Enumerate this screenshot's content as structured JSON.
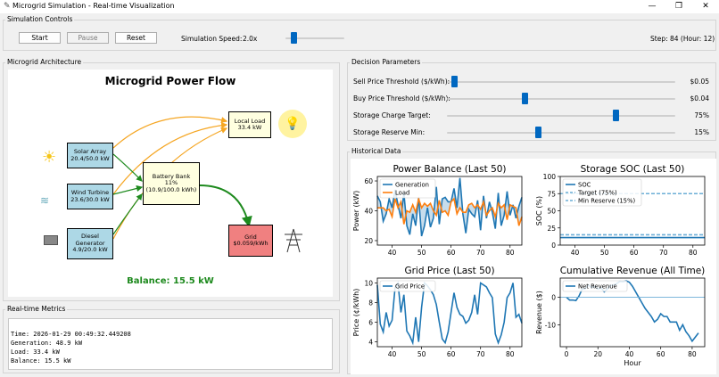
{
  "window": {
    "title": "Microgrid Simulation - Real-time Visualization",
    "min_icon": "minimize-icon",
    "max_icon": "maximize-icon",
    "close_icon": "close-icon"
  },
  "controls": {
    "title": "Simulation Controls",
    "start": "Start",
    "pause": "Pause",
    "reset": "Reset",
    "speed_label": "Simulation Speed:",
    "speed_value": "2.0x",
    "speed_fraction": 0.05,
    "step_text": "Step: 84 (Hour: 12)"
  },
  "architecture": {
    "frame_title": "Microgrid Architecture",
    "heading": "Microgrid Power Flow",
    "solar": {
      "name": "Solar Array",
      "value": "20.4/50.0 kW"
    },
    "wind": {
      "name": "Wind Turbine",
      "value": "23.6/30.0 kW"
    },
    "diesel": {
      "name": "Diesel",
      "name2": "Generator",
      "value": "4.9/20.0 kW"
    },
    "battery": {
      "name": "Battery Bank",
      "pct": "11%",
      "value": "(10.9/100.0 kWh)"
    },
    "load": {
      "name": "Local Load",
      "value": "33.4 kW"
    },
    "grid": {
      "name": "Grid",
      "value": "$0.059/kWh"
    },
    "balance": "Balance: 15.5 kW",
    "colors": {
      "solar_flow": "#f5a623",
      "wind_flow": "#2e8b2e",
      "solar_box": "#add8e6",
      "battery_box": "#ffffe0",
      "grid_box": "#f08080"
    }
  },
  "decision": {
    "title": "Decision Parameters",
    "params": [
      {
        "label": "Sell Price Threshold ($/kWh):",
        "value": "$0.05",
        "fraction": 0.02
      },
      {
        "label": "Buy Price Threshold ($/kWh):",
        "value": "$0.04",
        "fraction": 0.34
      },
      {
        "label": "Storage Charge Target:",
        "value": "75%",
        "fraction": 0.75
      },
      {
        "label": "Storage Reserve Min:",
        "value": "15%",
        "fraction": 0.4
      }
    ]
  },
  "metrics": {
    "title": "Real-time Metrics",
    "lines": [
      "Time: 2026-01-29 00:49:32.449208",
      "Generation: 48.9 kW",
      "Load: 33.4 kW",
      "Balance: 15.5 kW"
    ]
  },
  "historical": {
    "title": "Historical Data"
  },
  "chart_data": [
    {
      "type": "line",
      "title": "Power Balance (Last 50)",
      "xlabel": "",
      "ylabel": "Power (kW)",
      "xlim": [
        35,
        84
      ],
      "ylim": [
        17,
        63
      ],
      "xticks": [
        "40",
        "50",
        "60",
        "70",
        "80"
      ],
      "yticks": [
        "20",
        "40",
        "60"
      ],
      "legend": "top-left",
      "x": [
        35,
        36,
        37,
        38,
        39,
        40,
        41,
        42,
        43,
        44,
        45,
        46,
        47,
        48,
        49,
        50,
        51,
        52,
        53,
        54,
        55,
        56,
        57,
        58,
        59,
        60,
        61,
        62,
        63,
        64,
        65,
        66,
        67,
        68,
        69,
        70,
        71,
        72,
        73,
        74,
        75,
        76,
        77,
        78,
        79,
        80,
        81,
        82,
        83,
        84
      ],
      "series": [
        {
          "name": "Generation",
          "color": "#1f77b4",
          "values": [
            50,
            46,
            33,
            38,
            48,
            42,
            54,
            44,
            35,
            52,
            30,
            24,
            38,
            30,
            49,
            23,
            30,
            42,
            29,
            35,
            56,
            31,
            48,
            49,
            46,
            46,
            55,
            42,
            62,
            38,
            25,
            41,
            38,
            36,
            47,
            27,
            50,
            35,
            46,
            39,
            28,
            52,
            30,
            37,
            53,
            37,
            44,
            35,
            43,
            49
          ]
        },
        {
          "name": "Load",
          "color": "#ff7f0e",
          "values": [
            42,
            42,
            42,
            40,
            41,
            36,
            48,
            42,
            46,
            31,
            40,
            39,
            44,
            39,
            48,
            42,
            45,
            43,
            45,
            40,
            37,
            47,
            39,
            40,
            37,
            46,
            48,
            38,
            42,
            39,
            39,
            44,
            45,
            42,
            44,
            41,
            46,
            37,
            40,
            42,
            36,
            45,
            42,
            44,
            34,
            44,
            43,
            42,
            30,
            36
          ]
        }
      ]
    },
    {
      "type": "line",
      "title": "Storage SOC (Last 50)",
      "xlabel": "",
      "ylabel": "SOC (%)",
      "xlim": [
        35,
        84
      ],
      "ylim": [
        0,
        100
      ],
      "xticks": [
        "40",
        "50",
        "60",
        "70",
        "80"
      ],
      "yticks": [
        "0",
        "25",
        "50",
        "75",
        "100"
      ],
      "legend": "top-left",
      "series": [
        {
          "name": "SOC",
          "color": "#1f77b4",
          "values": [
            11
          ]
        },
        {
          "name": "Target (75%)",
          "color": "#6baed6",
          "values": [
            75
          ]
        },
        {
          "name": "Min Reserve (15%)",
          "color": "#6baed6",
          "values": [
            15
          ]
        }
      ]
    },
    {
      "type": "line",
      "title": "Grid Price (Last 50)",
      "xlabel": "",
      "ylabel": "Price (¢/kWh)",
      "xlim": [
        35,
        84
      ],
      "ylim": [
        3.5,
        10.5
      ],
      "xticks": [
        "40",
        "50",
        "60",
        "70",
        "80"
      ],
      "yticks": [
        "4",
        "6",
        "8",
        "10"
      ],
      "legend": "top-left",
      "x": [
        35,
        36,
        37,
        38,
        39,
        40,
        41,
        42,
        43,
        44,
        45,
        46,
        47,
        48,
        49,
        50,
        51,
        52,
        53,
        54,
        55,
        56,
        57,
        58,
        59,
        60,
        61,
        62,
        63,
        64,
        65,
        66,
        67,
        68,
        69,
        70,
        71,
        72,
        73,
        74,
        75,
        76,
        77,
        78,
        79,
        80,
        81,
        82,
        83,
        84
      ],
      "series": [
        {
          "name": "Grid Price",
          "color": "#1f77b4",
          "values": [
            9.8,
            5.8,
            5,
            7,
            5.6,
            6.2,
            9.5,
            10,
            7,
            8.8,
            5.1,
            4.6,
            3.9,
            6.5,
            4,
            7.5,
            10,
            9.7,
            9.3,
            8.8,
            7.8,
            6,
            4.3,
            3.9,
            5,
            7,
            9,
            7.5,
            6.8,
            6.6,
            5.9,
            6.2,
            7,
            8.8,
            6.8,
            10,
            9.8,
            9.6,
            9,
            8.5,
            4.8,
            3.9,
            4.7,
            6,
            8.5,
            9,
            10,
            6.5,
            6.8,
            5.9
          ]
        }
      ]
    },
    {
      "type": "line",
      "title": "Cumulative Revenue (All Time)",
      "xlabel": "Hour",
      "ylabel": "Revenue ($)",
      "xlim": [
        -4,
        88
      ],
      "ylim": [
        -18,
        7
      ],
      "xticks": [
        "0",
        "20",
        "40",
        "60",
        "80"
      ],
      "yticks": [
        "-10",
        "0"
      ],
      "legend": "top-left",
      "x": [
        0,
        2,
        4,
        6,
        8,
        10,
        12,
        14,
        16,
        18,
        20,
        22,
        24,
        26,
        28,
        30,
        32,
        34,
        36,
        38,
        40,
        42,
        44,
        46,
        48,
        50,
        52,
        54,
        56,
        58,
        60,
        62,
        64,
        66,
        68,
        70,
        72,
        74,
        76,
        78,
        80,
        82,
        84
      ],
      "series": [
        {
          "name": "Net Revenue",
          "color": "#1f77b4",
          "values": [
            0,
            -1,
            -1,
            -1.2,
            0.5,
            3,
            3.2,
            4.5,
            3.5,
            4,
            3,
            3.5,
            2,
            3,
            4.3,
            4.5,
            5,
            5.8,
            5.7,
            6,
            5.5,
            4,
            2,
            0,
            -2,
            -4,
            -5.5,
            -7,
            -9,
            -8,
            -6,
            -7,
            -7,
            -9,
            -9,
            -9,
            -12,
            -10,
            -12.5,
            -14,
            -16,
            -14.5,
            -13
          ]
        },
        {
          "name": "zero-line",
          "color": "#6baed6",
          "values": [
            0
          ]
        }
      ]
    }
  ]
}
